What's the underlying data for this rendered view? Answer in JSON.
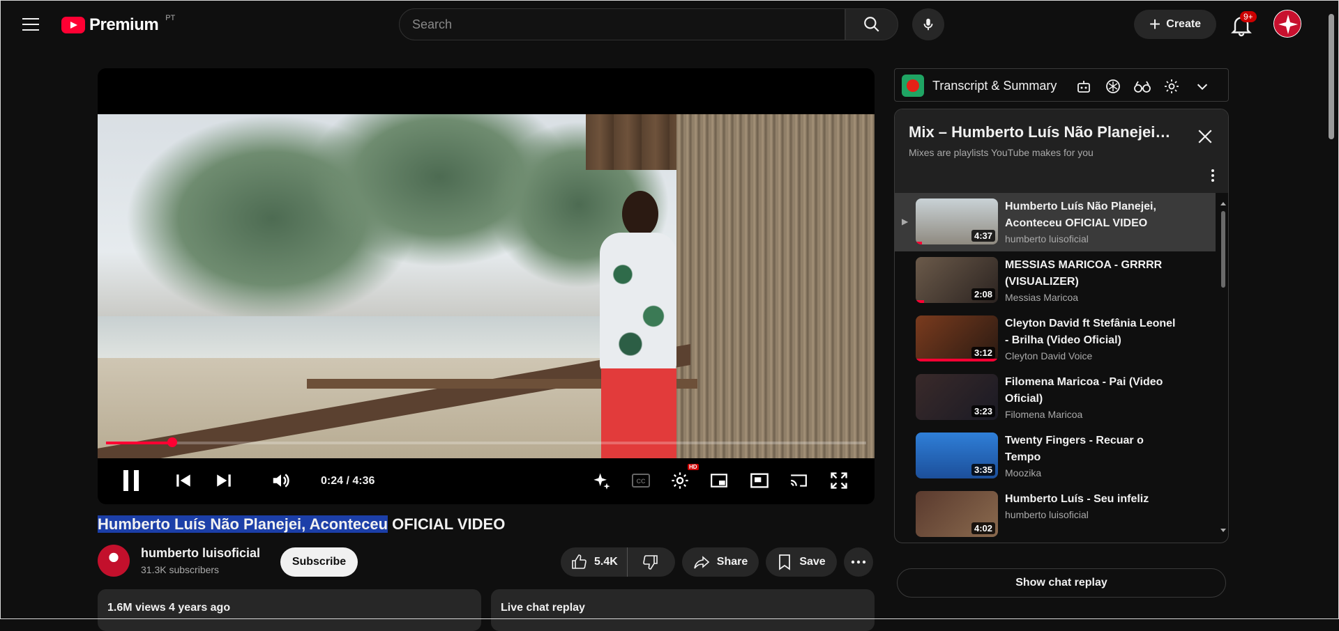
{
  "header": {
    "logo_text": "Premium",
    "country_code": "PT",
    "search_placeholder": "Search",
    "create_label": "Create",
    "notification_count": "9+"
  },
  "player": {
    "time": "0:24 / 4:36",
    "progress_fraction": 0.087,
    "hd_badge": "HD"
  },
  "video": {
    "title_highlighted": "Humberto Luís Não Planejei, Aconteceu",
    "title_rest": " OFICIAL VIDEO",
    "channel": "humberto luisoficial",
    "subscribers": "31.3K subscribers",
    "subscribe_label": "Subscribe",
    "likes": "5.4K",
    "share_label": "Share",
    "save_label": "Save",
    "views_date": "1.6M views  4 years ago",
    "live_chat_label": "Live chat replay"
  },
  "transcript": {
    "title": "Transcript & Summary"
  },
  "playlist": {
    "title": "Mix – Humberto Luís Não Planejei, Aconteceu OFICIAL VIDEO",
    "subtitle": "Mixes are playlists YouTube makes for you",
    "items": [
      {
        "title": "Humberto Luís Não Planejei, Aconteceu OFICIAL VIDEO",
        "channel": "humberto luisoficial",
        "duration": "4:37",
        "marker": "▶",
        "progress": 0.08
      },
      {
        "title": "MESSIAS MARICOA - GRRRR (VISUALIZER)",
        "channel": "Messias Maricoa",
        "duration": "2:08",
        "marker": "",
        "progress": 0.1
      },
      {
        "title": "Cleyton David ft Stefânia Leonel - Brilha (Video Oficial)",
        "channel": "Cleyton David Voice",
        "duration": "3:12",
        "marker": "",
        "progress": 1.0
      },
      {
        "title": "Filomena Maricoa - Pai (Video Oficial)",
        "channel": "Filomena Maricoa",
        "duration": "3:23",
        "marker": "",
        "progress": 0.0
      },
      {
        "title": "Twenty Fingers - Recuar o Tempo",
        "channel": "Moozika",
        "duration": "3:35",
        "marker": "",
        "progress": 0.0
      },
      {
        "title": "Humberto Luís - Seu infeliz",
        "channel": "humberto luisoficial",
        "duration": "4:02",
        "marker": "",
        "progress": 0.0
      }
    ]
  },
  "chat_replay_label": "Show chat replay"
}
